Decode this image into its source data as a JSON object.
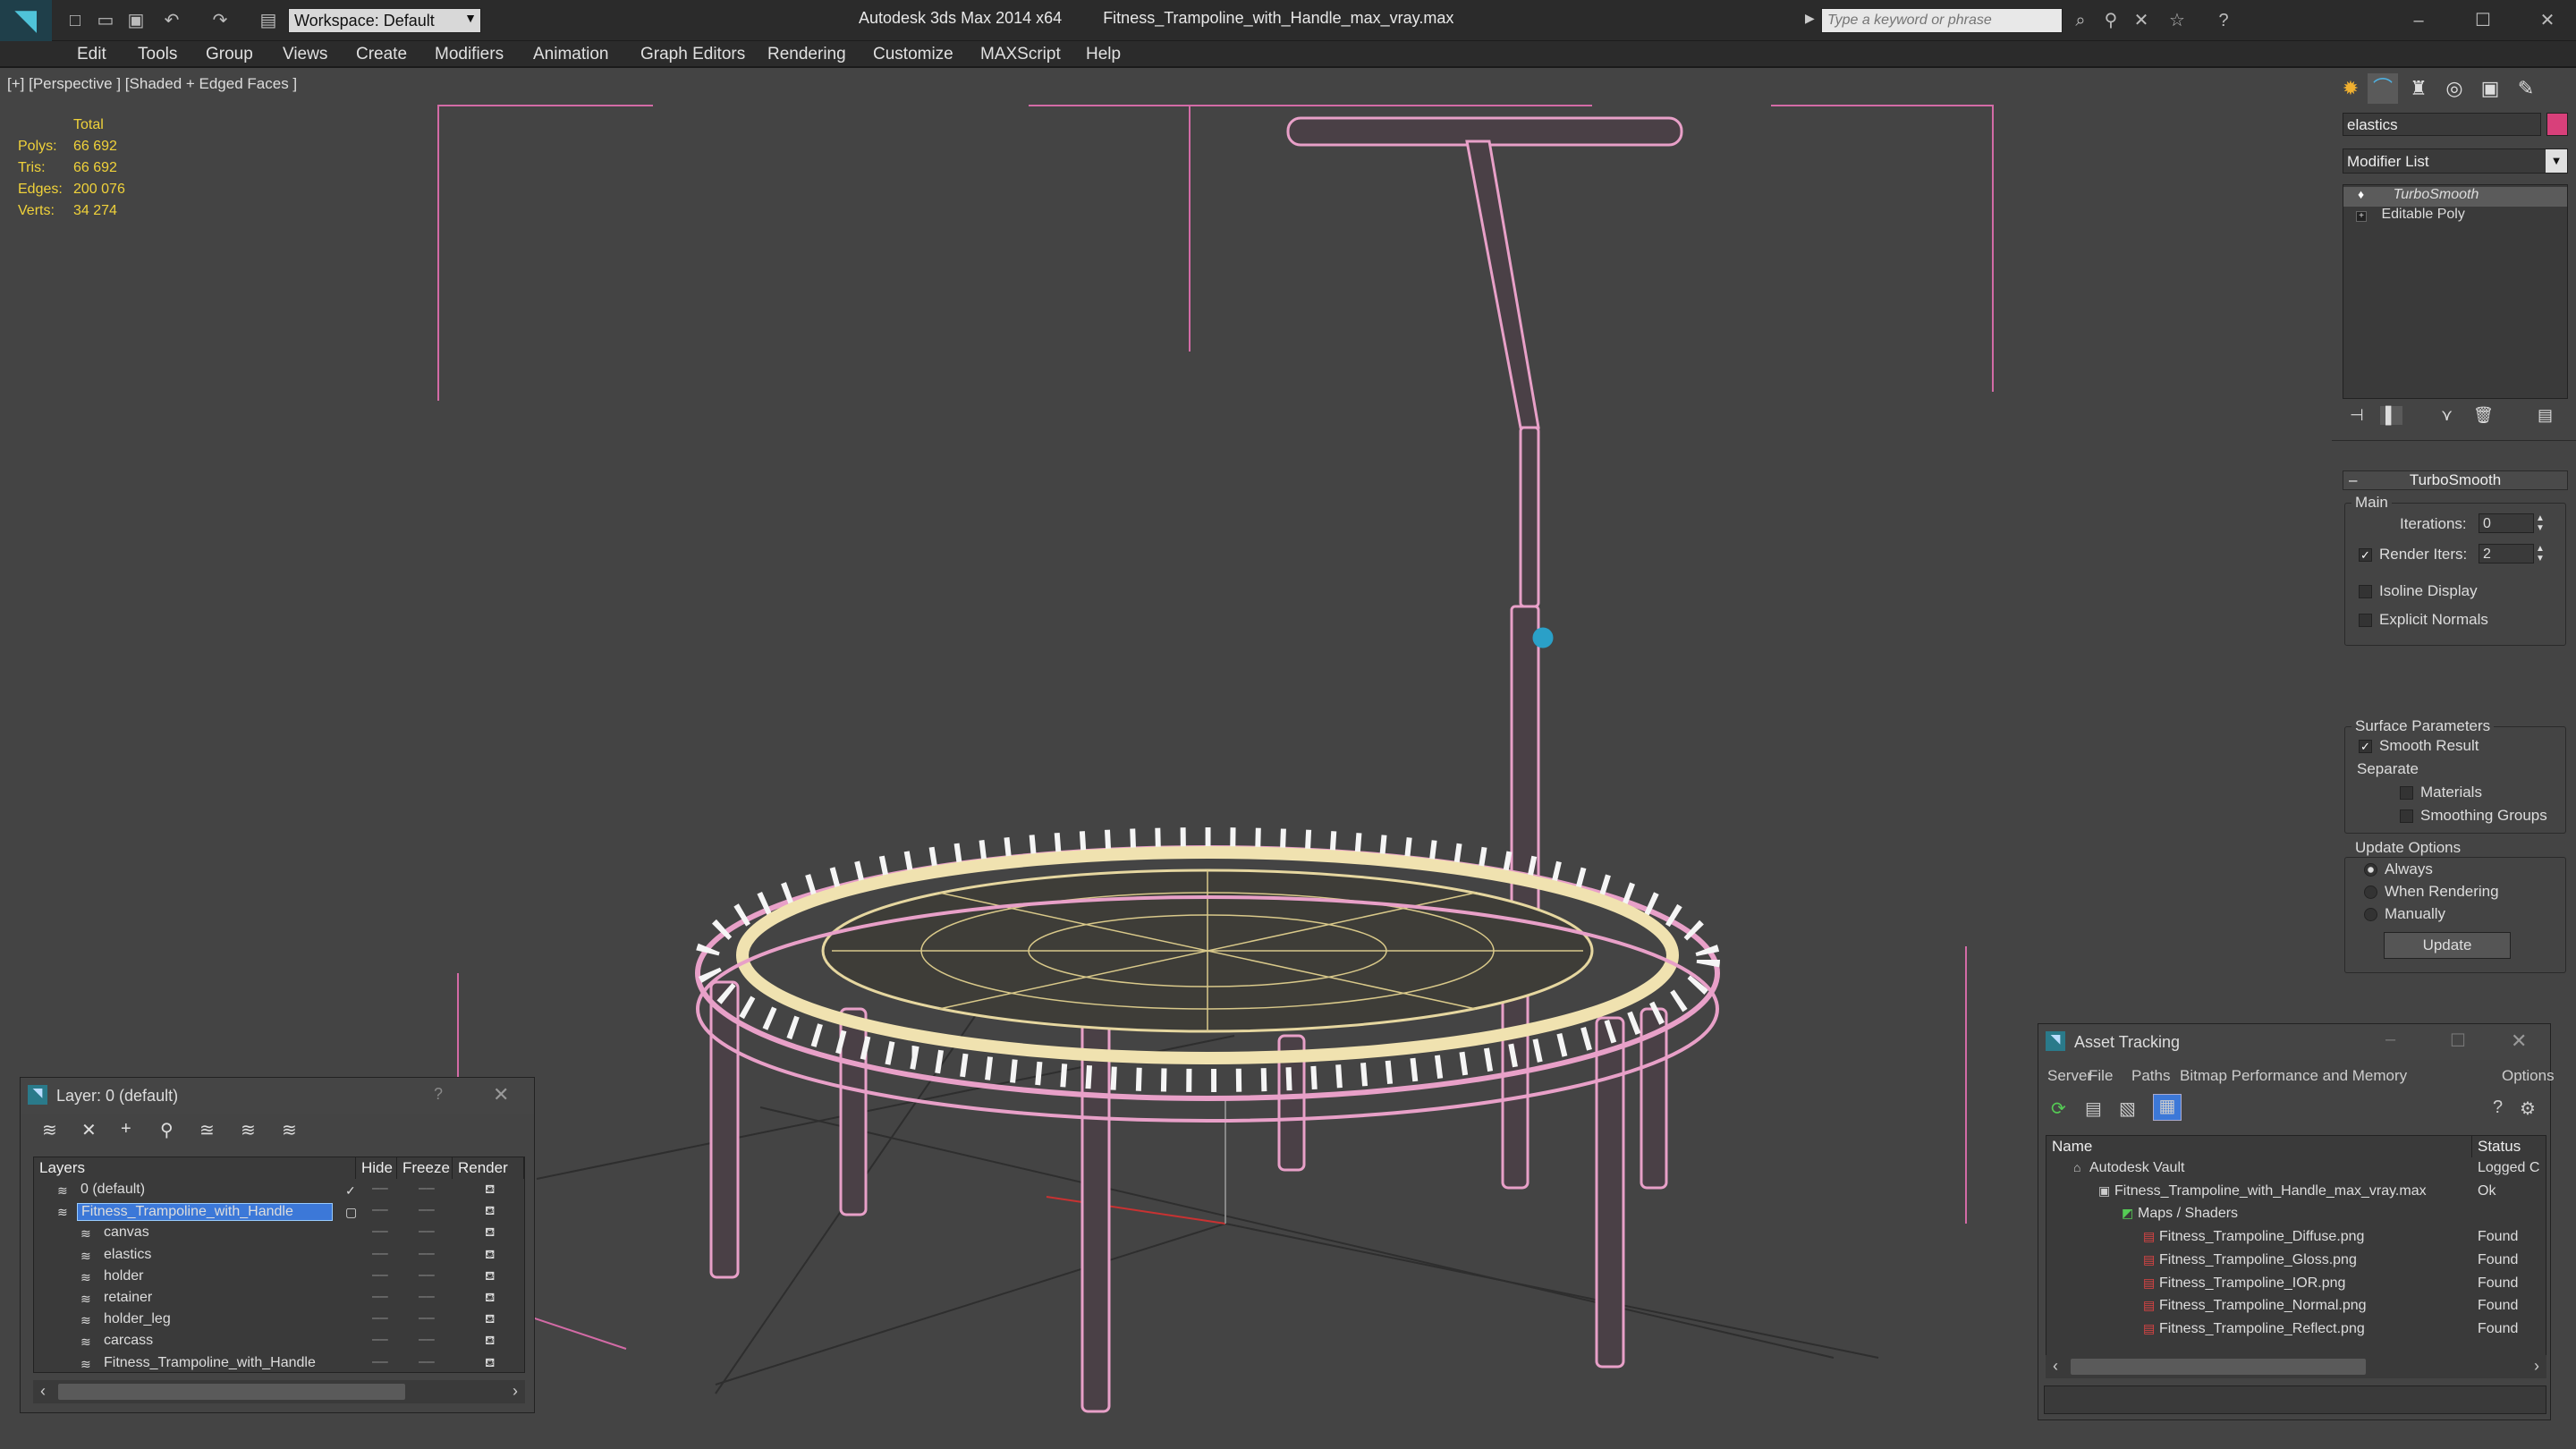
{
  "app": {
    "title": "Autodesk 3ds Max  2014 x64",
    "filename": "Fitness_Trampoline_with_Handle_max_vray.max",
    "workspace": "Workspace: Default",
    "search_placeholder": "Type a keyword or phrase"
  },
  "menu": [
    "Edit",
    "Tools",
    "Group",
    "Views",
    "Create",
    "Modifiers",
    "Animation",
    "Graph Editors",
    "Rendering",
    "Customize",
    "MAXScript",
    "Help"
  ],
  "viewport": {
    "label": "[+] [Perspective ] [Shaded + Edged Faces ]",
    "stats": {
      "header": "Total",
      "rows": [
        {
          "label": "Polys:",
          "value": "66 692"
        },
        {
          "label": "Tris:",
          "value": "66 692"
        },
        {
          "label": "Edges:",
          "value": "200 076"
        },
        {
          "label": "Verts:",
          "value": "34 274"
        }
      ]
    }
  },
  "command_panel": {
    "object_name": "elastics",
    "modifier_list": "Modifier List",
    "stack": [
      "TurboSmooth",
      "Editable Poly"
    ],
    "rollout_title": "TurboSmooth",
    "main_label": "Main",
    "iterations_label": "Iterations:",
    "iterations_value": "0",
    "render_iters_label": "Render Iters:",
    "render_iters_value": "2",
    "isoline": "Isoline Display",
    "explicit_normals": "Explicit Normals",
    "surface_params": "Surface Parameters",
    "smooth_result": "Smooth Result",
    "separate": "Separate",
    "materials": "Materials",
    "smoothing_groups": "Smoothing Groups",
    "update_options": "Update Options",
    "always": "Always",
    "when_rendering": "When Rendering",
    "manually": "Manually",
    "update_button": "Update"
  },
  "layer_window": {
    "title": "Layer: 0 (default)",
    "help": "?",
    "columns": [
      "Layers",
      "Hide",
      "Freeze",
      "Render"
    ],
    "layers": [
      {
        "name": "0 (default)",
        "level": 1,
        "selected": false
      },
      {
        "name": "Fitness_Trampoline_with_Handle",
        "level": 1,
        "selected": true
      },
      {
        "name": "canvas",
        "level": 2,
        "selected": false
      },
      {
        "name": "elastics",
        "level": 2,
        "selected": false
      },
      {
        "name": "holder",
        "level": 2,
        "selected": false
      },
      {
        "name": "retainer",
        "level": 2,
        "selected": false
      },
      {
        "name": "holder_leg",
        "level": 2,
        "selected": false
      },
      {
        "name": "carcass",
        "level": 2,
        "selected": false
      },
      {
        "name": "Fitness_Trampoline_with_Handle",
        "level": 2,
        "selected": false
      }
    ]
  },
  "asset_window": {
    "title": "Asset Tracking",
    "menu": [
      "Server",
      "File",
      "Paths",
      "Bitmap Performance and Memory",
      "Options"
    ],
    "columns": [
      "Name",
      "Status"
    ],
    "rows": [
      {
        "name": "Autodesk Vault",
        "status": "Logged C",
        "level": 0
      },
      {
        "name": "Fitness_Trampoline_with_Handle_max_vray.max",
        "status": "Ok",
        "level": 1
      },
      {
        "name": "Maps / Shaders",
        "status": "",
        "level": 2
      },
      {
        "name": "Fitness_Trampoline_Diffuse.png",
        "status": "Found",
        "level": 3
      },
      {
        "name": "Fitness_Trampoline_Gloss.png",
        "status": "Found",
        "level": 3
      },
      {
        "name": "Fitness_Trampoline_IOR.png",
        "status": "Found",
        "level": 3
      },
      {
        "name": "Fitness_Trampoline_Normal.png",
        "status": "Found",
        "level": 3
      },
      {
        "name": "Fitness_Trampoline_Reflect.png",
        "status": "Found",
        "level": 3
      }
    ]
  },
  "colors": {
    "wire": "#e8a0c8",
    "canvas": "#e6d7a0",
    "accent": "#3c78d8",
    "stats": "#f0d23a"
  }
}
